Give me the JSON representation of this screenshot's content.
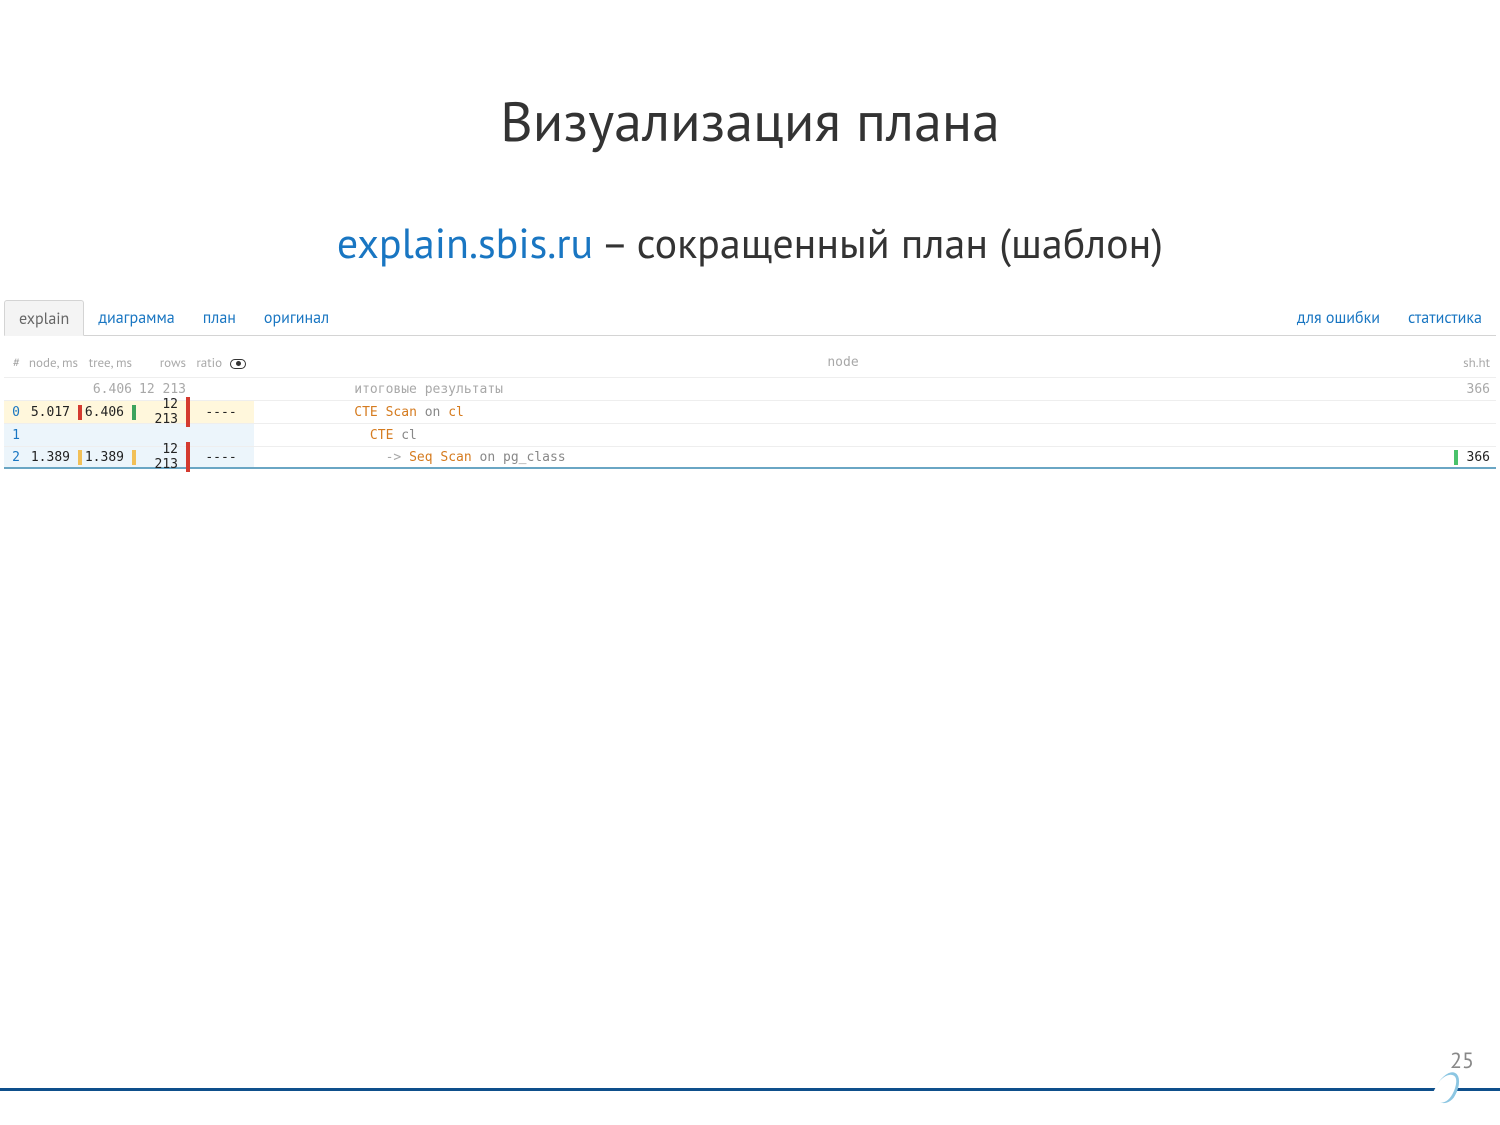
{
  "title": "Визуализация плана",
  "subtitle": {
    "link": "explain.sbis.ru",
    "rest": " – сокращенный план (шаблон)"
  },
  "tabs": {
    "left": [
      "explain",
      "диаграмма",
      "план",
      "оригинал"
    ],
    "right": [
      "для ошибки",
      "статистика"
    ],
    "active_index": 0
  },
  "table": {
    "headers": {
      "idx": "#",
      "nodems": "node, ms",
      "treems": "tree, ms",
      "rows": "rows",
      "ratio": "ratio",
      "node": "node",
      "sh": "sh.ht"
    },
    "rows": [
      {
        "idx": "",
        "nodems": "",
        "treems": "6.406",
        "rows": "12 213",
        "ratio": "",
        "node_html": {
          "prefix": "          ",
          "label": "итоговые результаты",
          "class": "dim"
        },
        "sh": "366",
        "sh_dim": true,
        "bars": {}
      },
      {
        "idx": "0",
        "nodems": "5.017",
        "treems": "6.406",
        "rows": "12 213",
        "ratio": "----",
        "node_html": {
          "prefix": "          ",
          "label_a": "CTE Scan",
          "mid": " on ",
          "label_b": "cl"
        },
        "sh": "",
        "bars": {
          "nodems": "#d43a2f",
          "treems": "#3da35d",
          "rows": "#d43a2f"
        },
        "row_class": "hl-row0"
      },
      {
        "idx": "1",
        "nodems": "",
        "treems": "",
        "rows": "",
        "ratio": "",
        "node_html": {
          "prefix": "            ",
          "label_a": "CTE",
          "mid": " ",
          "label_b": "cl",
          "b_dim": true
        },
        "sh": "",
        "bars": {},
        "row_class": "hl-row1"
      },
      {
        "idx": "2",
        "nodems": "1.389",
        "treems": "1.389",
        "rows": "12 213",
        "ratio": "----",
        "node_html": {
          "prefix": "              -> ",
          "label_a": "Seq Scan",
          "mid": " on ",
          "label_b": "pg_class",
          "b_dim": true,
          "prefix_dim": true
        },
        "sh": "366",
        "bars": {
          "nodems": "#f2c057",
          "treems": "#f2c057",
          "rows": "#d43a2f",
          "sh": "#49c26b"
        },
        "row_class": "hl-row2"
      }
    ]
  },
  "page_number": "25"
}
